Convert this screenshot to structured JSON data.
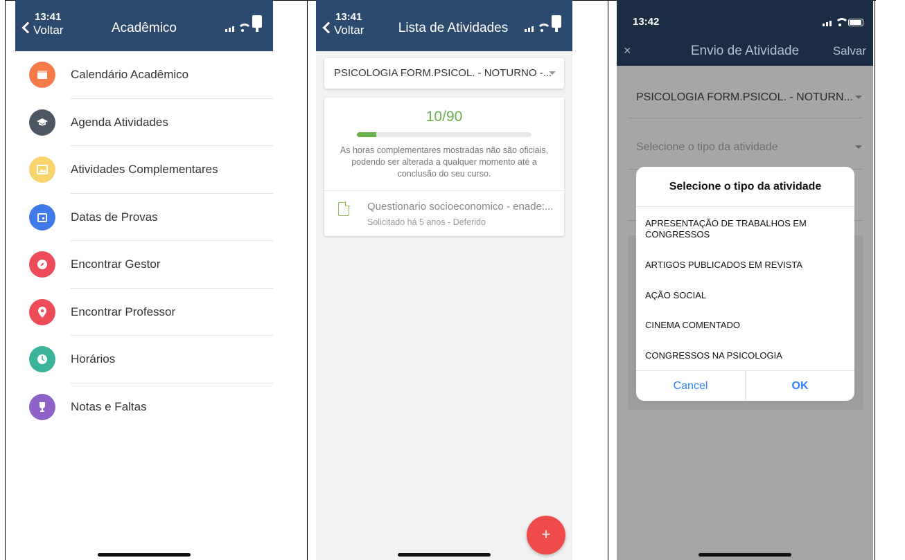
{
  "panel1": {
    "time": "13:41",
    "back_label": "Voltar",
    "title": "Acadêmico",
    "items": [
      {
        "label": "Calendário Acadêmico",
        "color": "#f57c4a",
        "icon": "calendar-icon"
      },
      {
        "label": "Agenda Atividades",
        "color": "#4c5763",
        "icon": "graduation-cap-icon"
      },
      {
        "label": "Atividades Complementares",
        "color": "#f9d46c",
        "icon": "image-icon"
      },
      {
        "label": "Datas de Provas",
        "color": "#3f7ae8",
        "icon": "calendar-day-icon"
      },
      {
        "label": "Encontrar Gestor",
        "color": "#ee4b5a",
        "icon": "compass-icon"
      },
      {
        "label": "Encontrar Professor",
        "color": "#ee4b5a",
        "icon": "map-pin-icon"
      },
      {
        "label": "Horários",
        "color": "#3bb39a",
        "icon": "clock-icon"
      },
      {
        "label": "Notas e Faltas",
        "color": "#8c62c6",
        "icon": "trophy-icon"
      }
    ]
  },
  "panel2": {
    "time": "13:41",
    "back_label": "Voltar",
    "title": "Lista de Atividades",
    "course_select": "PSICOLOGIA FORM.PSICOL. - NOTURNO -...",
    "hours": "10/90",
    "progress": 0.11,
    "disclaimer": "As horas complementares mostradas não são oficiais, podendo ser alterada a qualquer momento até a conclusão do seu curso.",
    "activity": {
      "title": "Questionario socioeconomico - enade:...",
      "subtitle": "Solicitado há 5 anos - Deferido"
    },
    "fab_label": "+"
  },
  "panel3": {
    "time": "13:42",
    "close_label": "×",
    "title": "Envio de Atividade",
    "save_label": "Salvar",
    "course_select": "PSICOLOGIA FORM.PSICOL. - NOTURN...",
    "type_placeholder": "Selecione o tipo da atividade",
    "dialog": {
      "title": "Selecione o tipo da atividade",
      "options": [
        "APRESENTAÇÃO DE TRABALHOS EM CONGRESSOS",
        "ARTIGOS PUBLICADOS EM REVISTA",
        "AÇÃO SOCIAL",
        "CINEMA COMENTADO",
        "CONGRESSOS NA PSICOLOGIA"
      ],
      "cancel_label": "Cancel",
      "ok_label": "OK"
    }
  }
}
